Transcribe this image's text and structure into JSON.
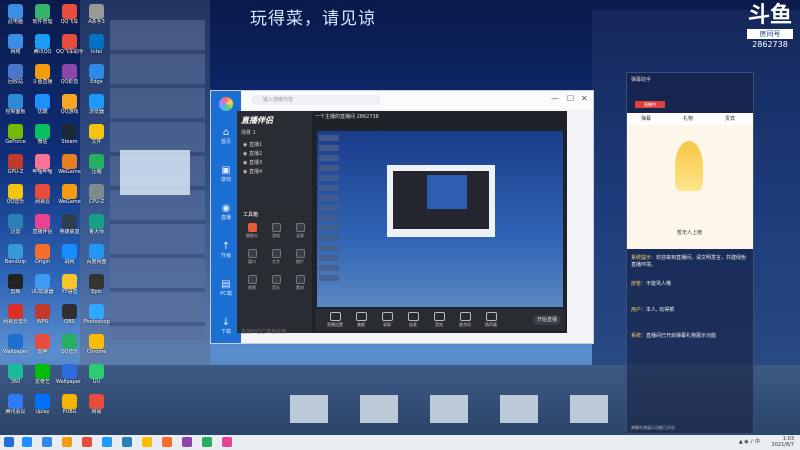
{
  "overlay_title": "玩得菜，请见谅",
  "logo": {
    "mark": "斗鱼",
    "room_tag": "房间号",
    "room_id": "2862738"
  },
  "desktop_icons": [
    {
      "label": "此电脑",
      "color": "#3b8ee8"
    },
    {
      "label": "软件管理",
      "color": "#35b36a"
    },
    {
      "label": "QQ飞车",
      "color": "#e74c3c"
    },
    {
      "label": "A杀手3",
      "color": "#999999"
    },
    {
      "label": "网络",
      "color": "#3b8ee8"
    },
    {
      "label": "腾讯QQ",
      "color": "#1b9af7"
    },
    {
      "label": "QQ飞车助手",
      "color": "#e74c3c"
    },
    {
      "label": "Intel",
      "color": "#0071c5"
    },
    {
      "label": "回收站",
      "color": "#4a77c9"
    },
    {
      "label": "斗鱼直播",
      "color": "#f39c12"
    },
    {
      "label": "QQ影音",
      "color": "#8e44ad"
    },
    {
      "label": "Edge",
      "color": "#2e8ae6"
    },
    {
      "label": "控制面板",
      "color": "#2d8bd6"
    },
    {
      "label": "优酷",
      "color": "#1e90ff"
    },
    {
      "label": "QQ游戏",
      "color": "#f5a623"
    },
    {
      "label": "浏览器",
      "color": "#1b9af7"
    },
    {
      "label": "GeForce",
      "color": "#76b900"
    },
    {
      "label": "微信",
      "color": "#07c160"
    },
    {
      "label": "Steam",
      "color": "#1b2838"
    },
    {
      "label": "文件",
      "color": "#f1c40f"
    },
    {
      "label": "GPU-Z",
      "color": "#c0392b"
    },
    {
      "label": "哔哩哔哩",
      "color": "#fb7299"
    },
    {
      "label": "WeGame",
      "color": "#e67e22"
    },
    {
      "label": "压缩",
      "color": "#27ae60"
    },
    {
      "label": "QQ音乐",
      "color": "#f1c40f"
    },
    {
      "label": "网易云",
      "color": "#e74c3c"
    },
    {
      "label": "WeGame",
      "color": "#f39c12"
    },
    {
      "label": "CPU-Z",
      "color": "#7f8c8d"
    },
    {
      "label": "迅雷",
      "color": "#2980b9"
    },
    {
      "label": "直播伴侣",
      "color": "#e84393"
    },
    {
      "label": "英雄联盟",
      "color": "#2c3e50"
    },
    {
      "label": "鲁大师",
      "color": "#16a085"
    },
    {
      "label": "Bandizip",
      "color": "#3498db"
    },
    {
      "label": "Origin",
      "color": "#f56c2d"
    },
    {
      "label": "战网",
      "color": "#148eff"
    },
    {
      "label": "百度网盘",
      "color": "#2196f3"
    },
    {
      "label": "剪映",
      "color": "#222222"
    },
    {
      "label": "UU加速器",
      "color": "#3c9cf5"
    },
    {
      "label": "YY语音",
      "color": "#f7c42c"
    },
    {
      "label": "Epic",
      "color": "#333333"
    },
    {
      "label": "网易云音乐",
      "color": "#d93025"
    },
    {
      "label": "WPS",
      "color": "#c0392b"
    },
    {
      "label": "OBS",
      "color": "#302e31"
    },
    {
      "label": "Photoshop",
      "color": "#31a8ff"
    },
    {
      "label": "Wallpaper",
      "color": "#1f6fd0"
    },
    {
      "label": "雷神",
      "color": "#e74c3c"
    },
    {
      "label": "QQ音乐",
      "color": "#27ae60"
    },
    {
      "label": "Chrome",
      "color": "#fbbc05"
    },
    {
      "label": "360",
      "color": "#1abc9c"
    },
    {
      "label": "爱奇艺",
      "color": "#00be06"
    },
    {
      "label": "Wallpaper Engine",
      "color": "#2d6cdf"
    },
    {
      "label": "UU",
      "color": "#2ecc71"
    },
    {
      "label": "腾讯会议",
      "color": "#2d7cf6"
    },
    {
      "label": "Uplay",
      "color": "#0070ff"
    },
    {
      "label": "PUBG",
      "color": "#f4b400"
    },
    {
      "label": "网易",
      "color": "#e74c3c"
    }
  ],
  "app_window": {
    "search_placeholder": "输入搜索内容",
    "nav": [
      {
        "label": "首页",
        "symbol": "⌂"
      },
      {
        "label": "游戏",
        "symbol": "▣"
      },
      {
        "label": "直播",
        "symbol": "◉"
      },
      {
        "label": "升级",
        "symbol": "↑"
      },
      {
        "label": "PC端",
        "symbol": "▤"
      },
      {
        "label": "下载",
        "symbol": "↓"
      }
    ],
    "inner": {
      "brand": "直播伴侣",
      "tab_scene": "场景 1",
      "scenes": [
        "直播1",
        "直播2",
        "直播3",
        "直播4"
      ],
      "tools_title": "工具箱",
      "tools": [
        "摄像头",
        "游戏",
        "全屏",
        "窗口",
        "文字",
        "图片",
        "视频",
        "音乐",
        "素材"
      ],
      "room_title": "一个主播的直播间 2862738",
      "start_live": "开始直播",
      "bottom_tools": [
        "直播设置",
        "美颜",
        "录屏",
        "连麦",
        "音效",
        "麦克风",
        "扬声器"
      ],
      "status": "直播伴侣已准备就绪"
    }
  },
  "chat": {
    "header": "弹幕助手",
    "live_tag": "直播中",
    "tabs": [
      "弹幕",
      "礼物",
      "贵宾"
    ],
    "banner_caption": "暂无人上榜",
    "messages": [
      {
        "name": "系统提示：",
        "text": "欢迎来到直播间，请文明发言，共建绿色直播环境。"
      },
      {
        "name": "房管：",
        "text": "不能骂人哦"
      },
      {
        "name": "用户：",
        "text": "本人, 玩得菜"
      },
      {
        "name": "系统：",
        "text": "直播间已开启弹幕礼物展示功能"
      }
    ],
    "footer": "弹幕礼物展示功能已开启"
  },
  "taskbar": {
    "apps": [
      "#1e90ff",
      "#2e8ae6",
      "#f39c12",
      "#e74c3c",
      "#1b9af7",
      "#2980b9",
      "#fbbc05",
      "#f56c2d",
      "#8e44ad",
      "#27ae60",
      "#e84393"
    ],
    "time": "1:03",
    "date": "2021/8/7"
  }
}
